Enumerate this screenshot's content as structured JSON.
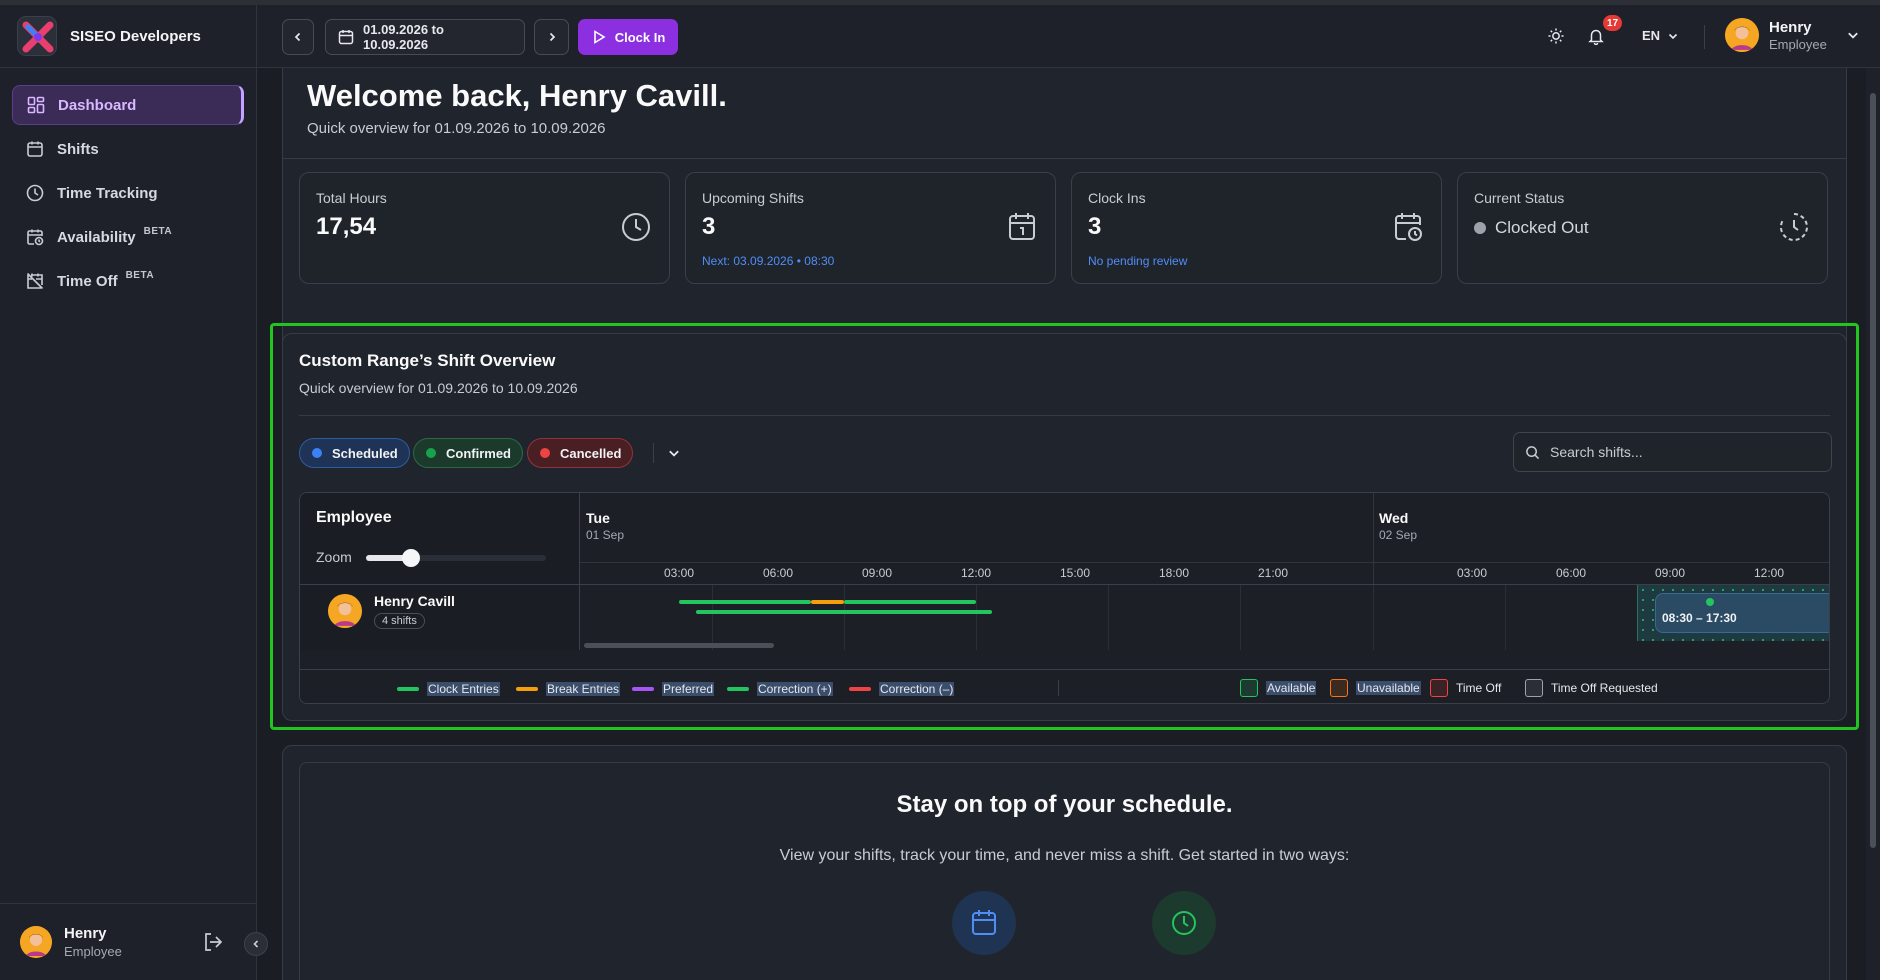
{
  "app": {
    "brand": "SISEO Developers"
  },
  "sidebar": {
    "items": [
      {
        "label": "Dashboard",
        "icon": "dashboard-icon",
        "active": true
      },
      {
        "label": "Shifts",
        "icon": "calendar-icon"
      },
      {
        "label": "Time Tracking",
        "icon": "clock-icon"
      },
      {
        "label": "Availability",
        "icon": "calendar-clock-icon",
        "badge": "BETA"
      },
      {
        "label": "Time Off",
        "icon": "alarm-off-icon",
        "badge": "BETA"
      }
    ],
    "user": {
      "name": "Henry",
      "role": "Employee"
    }
  },
  "header": {
    "date_range": "01.09.2026 to 10.09.2026",
    "clock_in_label": "Clock In",
    "notification_count": "17",
    "language": "EN",
    "user": {
      "name": "Henry",
      "role": "Employee"
    }
  },
  "welcome": {
    "title": "Welcome back, Henry Cavill.",
    "subtitle": "Quick overview for 01.09.2026 to 10.09.2026"
  },
  "stats": [
    {
      "label": "Total Hours",
      "value": "17,54",
      "note": "",
      "icon": "clock-icon"
    },
    {
      "label": "Upcoming Shifts",
      "value": "3",
      "note": "Next: 03.09.2026 • 08:30",
      "icon": "calendar-day-icon"
    },
    {
      "label": "Clock Ins",
      "value": "3",
      "note": "No pending review",
      "icon": "calendar-clock-icon"
    },
    {
      "label": "Current Status",
      "value": "Clocked Out",
      "note": "",
      "icon": "history-icon"
    }
  ],
  "overview": {
    "title": "Custom Range’s Shift Overview",
    "subtitle": "Quick overview for 01.09.2026 to 10.09.2026",
    "filters": [
      {
        "label": "Scheduled",
        "color": "#3b82f6"
      },
      {
        "label": "Confirmed",
        "color": "#16a34a"
      },
      {
        "label": "Cancelled",
        "color": "#ef4444"
      }
    ],
    "search_placeholder": "Search shifts...",
    "employee_header": "Employee",
    "zoom_label": "Zoom",
    "zoom_level": 0.25,
    "days": [
      {
        "day": "Tue",
        "date": "01 Sep"
      },
      {
        "day": "Wed",
        "date": "02 Sep"
      }
    ],
    "hour_ticks": [
      "03:00",
      "06:00",
      "09:00",
      "12:00",
      "15:00",
      "18:00",
      "21:00",
      "03:00",
      "06:00",
      "09:00",
      "12:00"
    ],
    "employee": {
      "name": "Henry Cavill",
      "shifts": "4 shifts"
    },
    "shift_chip": "08:30 – 17:30",
    "legend_lines": [
      {
        "label": "Clock Entries",
        "color": "#22c55e"
      },
      {
        "label": "Break Entries",
        "color": "#f59e0b"
      },
      {
        "label": "Preferred",
        "color": "#a855f7"
      },
      {
        "label": "Correction (+)",
        "color": "#22c55e"
      },
      {
        "label": "Correction (–)",
        "color": "#ef4444"
      }
    ],
    "legend_boxes": [
      {
        "label": "Available",
        "color": "#22c55e"
      },
      {
        "label": "Unavailable",
        "color": "#f97316"
      },
      {
        "label": "Time Off",
        "color": "#ef4444"
      },
      {
        "label": "Time Off Requested",
        "color": "#9ca3af"
      }
    ]
  },
  "cta": {
    "title": "Stay on top of your schedule.",
    "subtitle": "View your shifts, track your time, and never miss a shift. Get started in two ways:"
  }
}
